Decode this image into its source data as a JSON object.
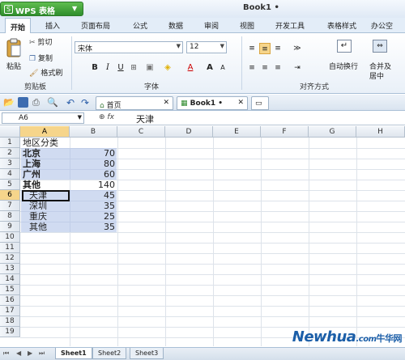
{
  "app": {
    "name": "WPS 表格",
    "doc_title": "Book1 •"
  },
  "tabs": [
    "开始",
    "插入",
    "页面布局",
    "公式",
    "数据",
    "审阅",
    "视图",
    "开发工具",
    "表格样式",
    "办公空"
  ],
  "ribbon": {
    "paste": "粘贴",
    "cut": "剪切",
    "copy": "复制",
    "format_painter": "格式刷",
    "clipboard_group": "剪贴板",
    "font_name": "宋体",
    "font_size": "12",
    "bold": "B",
    "italic": "I",
    "underline": "U",
    "font_color": "A",
    "grow_font": "A",
    "shrink_font": "A",
    "font_group": "字体",
    "wrap": "自动换行",
    "merge": "合并及",
    "merge2": "居中",
    "align_group": "对齐方式"
  },
  "doc_tabs": [
    "首页",
    "Book1 •"
  ],
  "formula": {
    "name_box": "A6",
    "fx": "fx",
    "content": "天津"
  },
  "columns": [
    "A",
    "B",
    "C",
    "D",
    "E",
    "F",
    "G",
    "H"
  ],
  "rows": [
    "1",
    "2",
    "3",
    "4",
    "5",
    "6",
    "7",
    "8",
    "9",
    "10",
    "11",
    "12",
    "13",
    "14",
    "15",
    "16",
    "17",
    "18",
    "19"
  ],
  "cells": {
    "a1": "地区分类",
    "a2": "北京",
    "b2": "70",
    "a3": "上海",
    "b3": "80",
    "a4": "广州",
    "b4": "60",
    "a5": "其他",
    "b5": "140",
    "a6": "天津",
    "b6": "45",
    "a7": "深圳",
    "b7": "35",
    "a8": "重庆",
    "b8": "25",
    "a9": "其他",
    "b9": "35"
  },
  "sheets": [
    "Sheet1",
    "Sheet2",
    "Sheet3"
  ],
  "watermark": {
    "brand": "Newhua",
    "suffix": ".com",
    "cn": "牛华网"
  }
}
